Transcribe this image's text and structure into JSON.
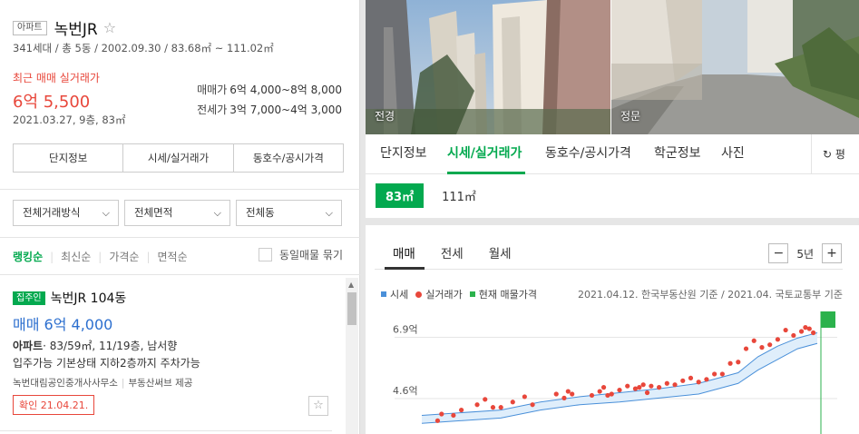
{
  "left": {
    "badge": "아파트",
    "name": "녹번JR",
    "meta": "341세대 / 총 5동 / 2002.09.30 / 83.68㎡ ~ 111.02㎡",
    "recent": {
      "label": "최근 매매 실거래가",
      "price": "6억 5,500",
      "date": "2021.03.27, 9층, 83㎡"
    },
    "prices": [
      {
        "key": "매매가",
        "value": "6억 4,000~8억 8,000"
      },
      {
        "key": "전세가",
        "value": "3억 7,000~4억 3,000"
      }
    ],
    "tabs": [
      "단지정보",
      "시세/실거래가",
      "동호수/공시가격"
    ],
    "filters": [
      "전체거래방식",
      "전체면적",
      "전체동"
    ],
    "sorts": [
      "랭킹순",
      "최신순",
      "가격순",
      "면적순"
    ],
    "group_label": "동일매물 묶기",
    "listing": {
      "badge": "집주인",
      "name": "녹번JR 104동",
      "price": "매매 6억 4,000",
      "type": "아파트",
      "info": "· 83/59㎡, 11/19층, 남서향",
      "desc": "입주가능 기본상태 지하2층까지 주차가능",
      "agent": "녹번대림공인중개사사무소",
      "provider": "부동산써브 제공",
      "confirm": "확인 21.04.21."
    }
  },
  "right": {
    "photos": [
      {
        "caption": "전경"
      },
      {
        "caption": "정문"
      }
    ],
    "tabs": [
      "단지정보",
      "시세/실거래가",
      "동호수/공시가격",
      "학군정보",
      "사진"
    ],
    "refresh": "평",
    "areas": [
      "83㎡",
      "111㎡"
    ],
    "chart_tabs": [
      "매매",
      "전세",
      "월세"
    ],
    "period": "5년",
    "minus": "−",
    "plus": "+",
    "legend": [
      {
        "label": "시세",
        "color": "#4a90d9"
      },
      {
        "label": "실거래가",
        "color": "#e8473b"
      },
      {
        "label": "현재 매물가격",
        "color": "#2bb24c"
      }
    ],
    "source": "2021.04.12. 한국부동산원 기준 / 2021.04. 국토교통부 기준"
  },
  "chart_data": {
    "type": "scatter",
    "y_ticks": [
      "6.9억",
      "4.6억"
    ],
    "ylabel": "",
    "series": [
      {
        "name": "실거래가",
        "color": "#e8473b",
        "points": [
          [
            0.04,
            3.5
          ],
          [
            0.05,
            3.75
          ],
          [
            0.08,
            3.7
          ],
          [
            0.1,
            3.9
          ],
          [
            0.14,
            4.1
          ],
          [
            0.16,
            4.3
          ],
          [
            0.18,
            4.0
          ],
          [
            0.2,
            4.0
          ],
          [
            0.23,
            4.2
          ],
          [
            0.26,
            4.4
          ],
          [
            0.28,
            4.1
          ],
          [
            0.34,
            4.5
          ],
          [
            0.36,
            4.35
          ],
          [
            0.37,
            4.6
          ],
          [
            0.38,
            4.5
          ],
          [
            0.43,
            4.45
          ],
          [
            0.45,
            4.6
          ],
          [
            0.46,
            4.75
          ],
          [
            0.47,
            4.45
          ],
          [
            0.48,
            4.5
          ],
          [
            0.5,
            4.65
          ],
          [
            0.52,
            4.8
          ],
          [
            0.54,
            4.7
          ],
          [
            0.55,
            4.75
          ],
          [
            0.56,
            4.85
          ],
          [
            0.57,
            4.55
          ],
          [
            0.58,
            4.8
          ],
          [
            0.6,
            4.75
          ],
          [
            0.62,
            4.9
          ],
          [
            0.64,
            4.85
          ],
          [
            0.66,
            5.0
          ],
          [
            0.68,
            5.1
          ],
          [
            0.7,
            4.95
          ],
          [
            0.72,
            5.05
          ],
          [
            0.74,
            5.25
          ],
          [
            0.76,
            5.25
          ],
          [
            0.78,
            5.65
          ],
          [
            0.8,
            5.7
          ],
          [
            0.82,
            6.2
          ],
          [
            0.84,
            6.5
          ],
          [
            0.86,
            6.25
          ],
          [
            0.88,
            6.35
          ],
          [
            0.9,
            6.55
          ],
          [
            0.92,
            6.9
          ],
          [
            0.94,
            6.7
          ],
          [
            0.96,
            6.85
          ],
          [
            0.97,
            7.0
          ],
          [
            0.98,
            6.95
          ],
          [
            0.99,
            6.8
          ]
        ]
      },
      {
        "name": "시세",
        "color": "#4a90d9",
        "band_lower": [
          [
            0.0,
            3.4
          ],
          [
            0.2,
            3.6
          ],
          [
            0.3,
            3.9
          ],
          [
            0.4,
            4.1
          ],
          [
            0.5,
            4.2
          ],
          [
            0.6,
            4.35
          ],
          [
            0.7,
            4.5
          ],
          [
            0.8,
            4.9
          ],
          [
            0.85,
            5.4
          ],
          [
            0.9,
            5.8
          ],
          [
            0.95,
            6.2
          ],
          [
            1.0,
            6.4
          ]
        ],
        "band_upper": [
          [
            0.0,
            3.7
          ],
          [
            0.2,
            3.9
          ],
          [
            0.3,
            4.2
          ],
          [
            0.4,
            4.4
          ],
          [
            0.5,
            4.55
          ],
          [
            0.6,
            4.7
          ],
          [
            0.7,
            4.9
          ],
          [
            0.8,
            5.3
          ],
          [
            0.85,
            5.9
          ],
          [
            0.9,
            6.3
          ],
          [
            0.95,
            6.6
          ],
          [
            1.0,
            6.8
          ]
        ]
      },
      {
        "name": "현재 매물가격",
        "color": "#2bb24c",
        "range": [
          6.4,
          8.8
        ]
      }
    ],
    "ylim": [
      3.0,
      7.6
    ]
  }
}
